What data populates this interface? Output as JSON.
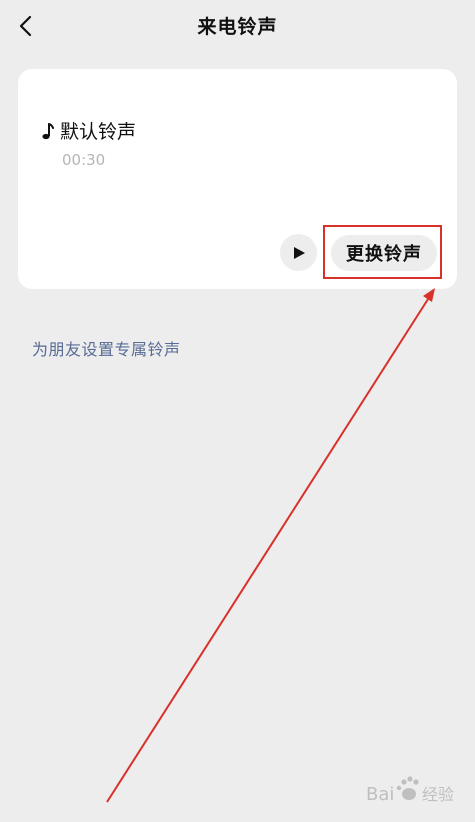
{
  "header": {
    "title": "来电铃声",
    "back_icon": "chevron-left-icon"
  },
  "card": {
    "ringtone_name": "默认铃声",
    "ringtone_duration": "00:30",
    "note_icon": "music-note-icon",
    "play_icon": "play-icon",
    "change_button_label": "更换铃声"
  },
  "friend_link": "为朋友设置专属铃声",
  "colors": {
    "background": "#ededed",
    "card": "#ffffff",
    "link": "#576b95",
    "annotation": "#d9302a"
  },
  "watermark_text": "Baidu经验"
}
